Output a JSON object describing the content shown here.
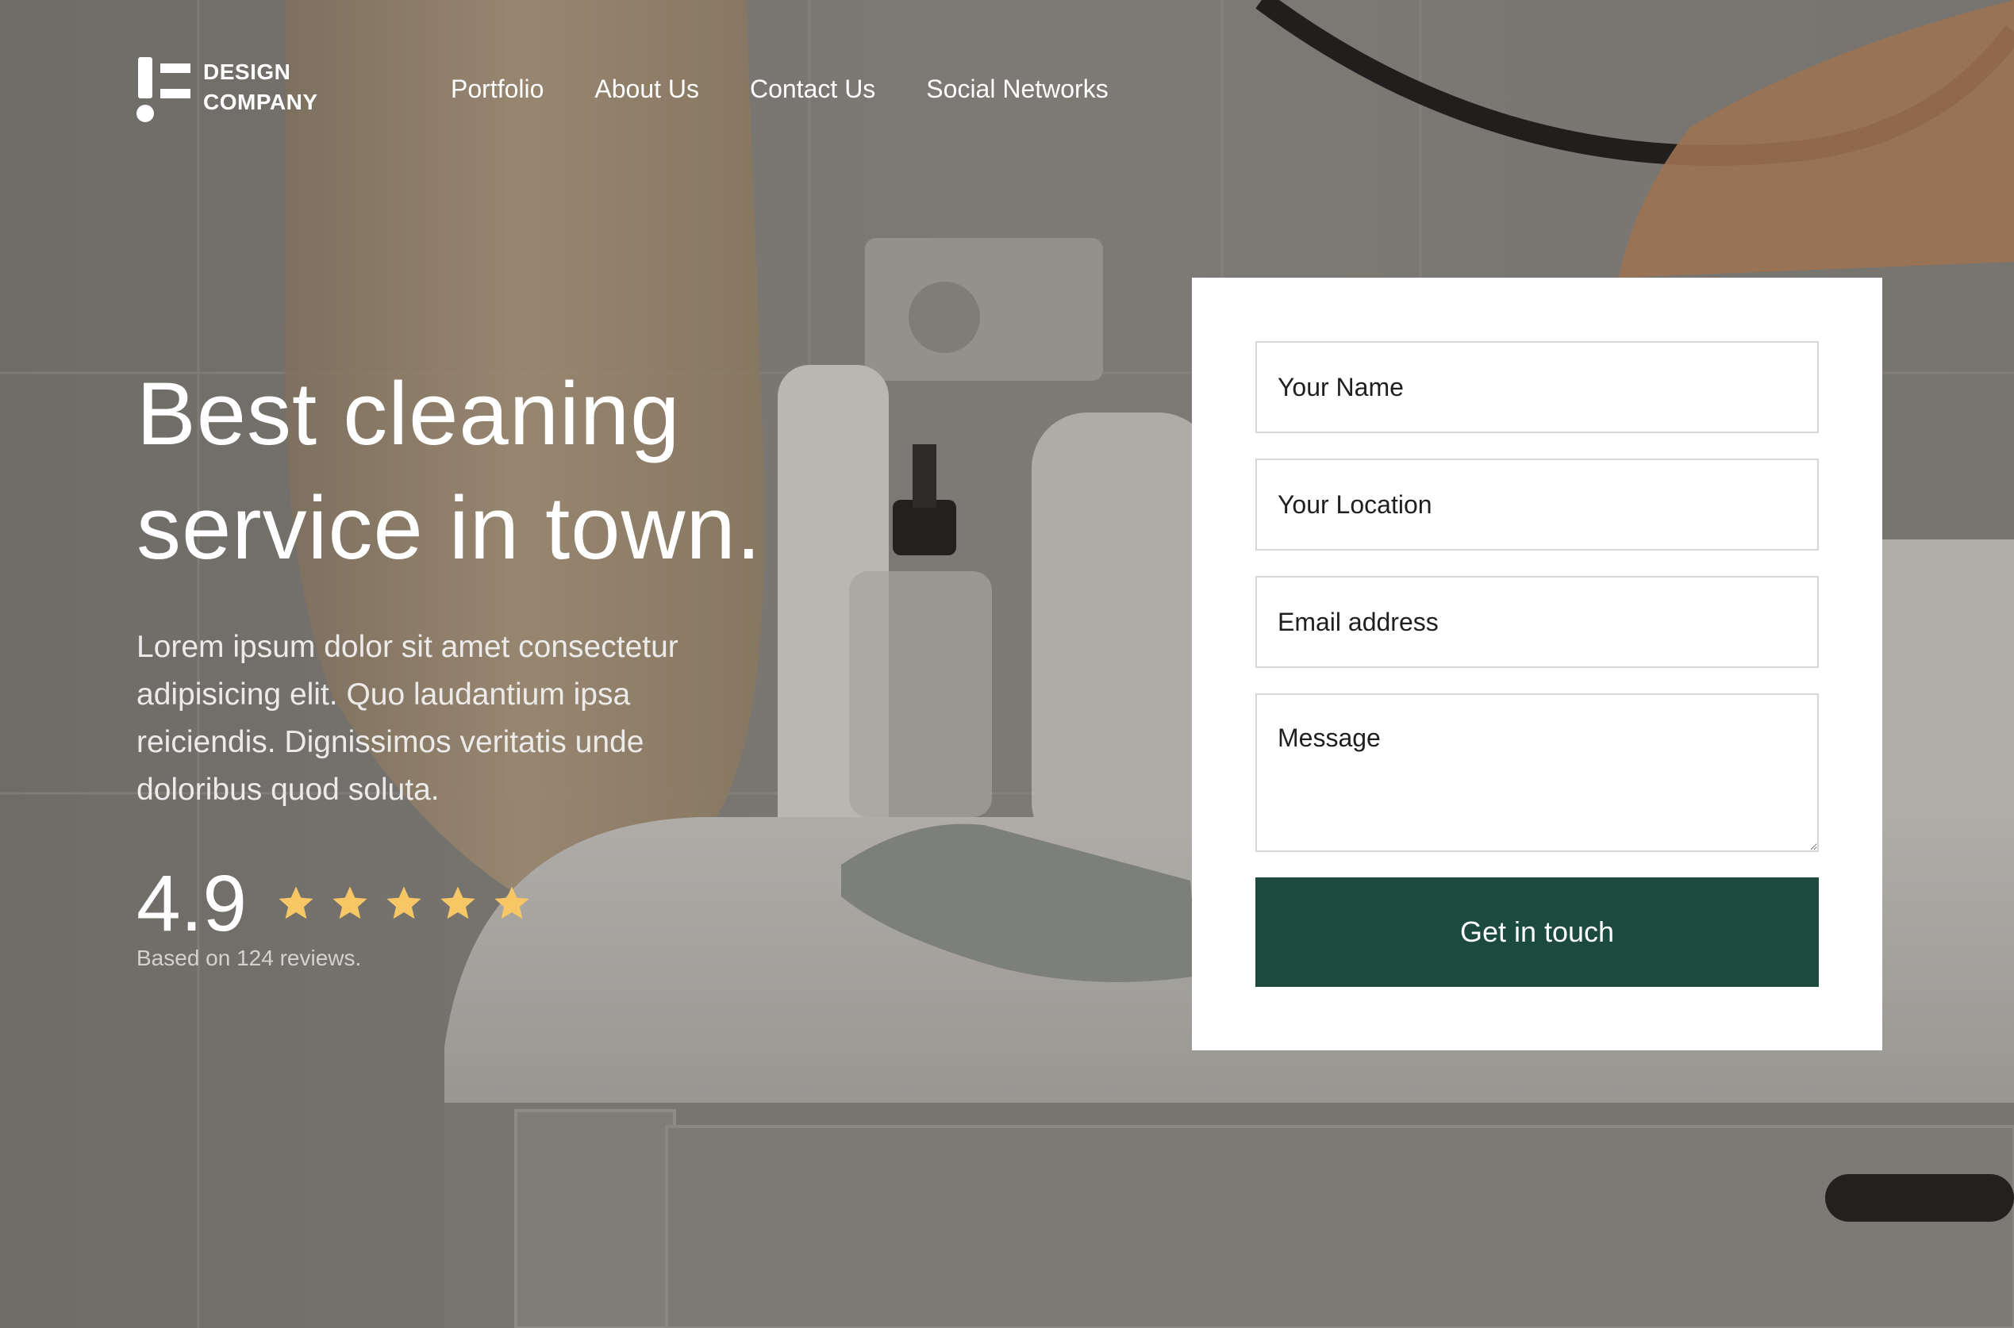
{
  "brand": {
    "name_line1": "DESIGN",
    "name_line2": "COMPANY"
  },
  "nav": {
    "items": [
      {
        "label": "Portfolio"
      },
      {
        "label": "About Us"
      },
      {
        "label": "Contact Us"
      },
      {
        "label": "Social Networks"
      }
    ]
  },
  "hero": {
    "title": "Best cleaning service in town.",
    "description": "Lorem ipsum dolor sit amet consectetur adipisicing elit. Quo laudantium ipsa reiciendis. Dignissimos veritatis unde doloribus quod soluta.",
    "rating": {
      "score": "4.9",
      "stars": 5,
      "note": "Based on 124 reviews.",
      "star_color": "#f7c766"
    }
  },
  "form": {
    "name_placeholder": "Your Name",
    "location_placeholder": "Your Location",
    "email_placeholder": "Email address",
    "message_placeholder": "Message",
    "submit_label": "Get in touch",
    "submit_color": "#1d4a3f"
  }
}
